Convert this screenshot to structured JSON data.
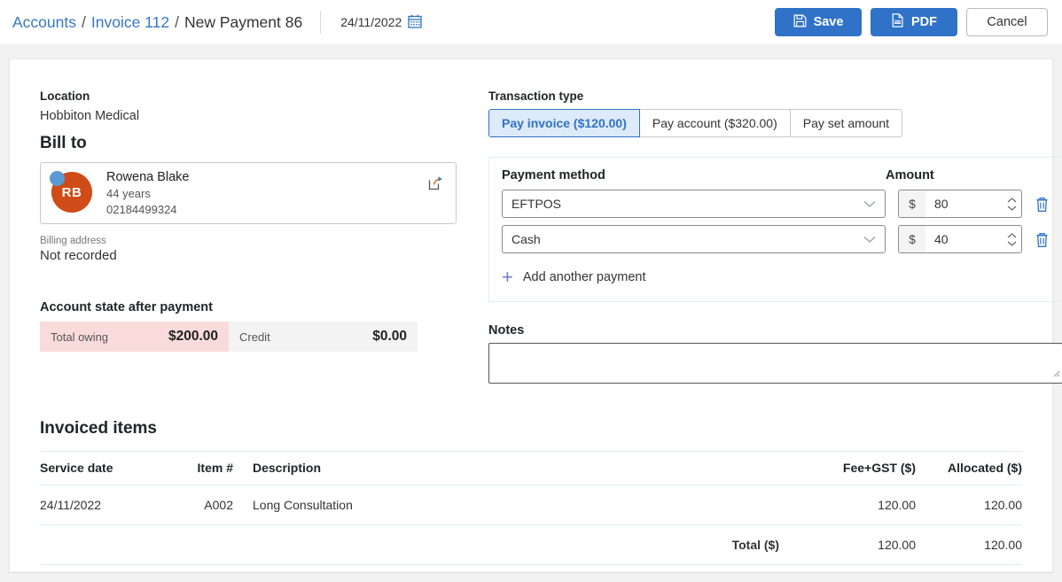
{
  "header": {
    "breadcrumb": [
      {
        "label": "Accounts",
        "link": true
      },
      {
        "label": "Invoice 112",
        "link": true
      },
      {
        "label": "New Payment 86",
        "link": false
      }
    ],
    "separator": "/",
    "date": "24/11/2022",
    "calendar_icon": "calendar-icon",
    "actions": {
      "save": "Save",
      "save_icon": "save-floppy-icon",
      "pdf": "PDF",
      "pdf_icon": "pdf-document-icon",
      "cancel": "Cancel"
    }
  },
  "left": {
    "location_label": "Location",
    "location_value": "Hobbiton Medical",
    "bill_to_heading": "Bill to",
    "patient": {
      "initials": "RB",
      "name": "Rowena Blake",
      "age": "44 years",
      "phone": "02184499324",
      "share_icon": "external-link-icon",
      "status_dot": "online-status-dot"
    },
    "billing_address_label": "Billing address",
    "billing_address_value": "Not recorded",
    "account_state": {
      "title": "Account state after payment",
      "owing_label": "Total owing",
      "owing_value": "$200.00",
      "credit_label": "Credit",
      "credit_value": "$0.00"
    }
  },
  "right": {
    "transaction_type_label": "Transaction type",
    "tabs": [
      {
        "label": "Pay invoice ($120.00)",
        "active": true
      },
      {
        "label": "Pay account ($320.00)",
        "active": false
      },
      {
        "label": "Pay set amount",
        "active": false
      }
    ],
    "payment_method_header": "Payment method",
    "amount_header": "Amount",
    "currency_symbol": "$",
    "payments": [
      {
        "method": "EFTPOS",
        "amount": "80"
      },
      {
        "method": "Cash",
        "amount": "40"
      }
    ],
    "add_payment_label": "Add another payment",
    "add_payment_icon": "plus-icon",
    "delete_icon": "trash-icon",
    "dropdown_icon": "chevron-down-icon",
    "spinner_icon": "stepper-arrows-icon",
    "notes_label": "Notes",
    "notes_value": "",
    "notes_placeholder": ""
  },
  "items": {
    "title": "Invoiced items",
    "columns": [
      "Service date",
      "Item #",
      "Description",
      "Fee+GST ($)",
      "Allocated ($)"
    ],
    "rows": [
      {
        "service_date": "24/11/2022",
        "item_no": "A002",
        "description": "Long Consultation",
        "fee_gst": "120.00",
        "allocated": "120.00"
      }
    ],
    "total_label": "Total ($)",
    "total_fee": "120.00",
    "total_allocated": "120.00"
  },
  "colors": {
    "accent_blue": "#2f72c7",
    "link_blue": "#3877c4",
    "avatar_orange": "#cf4b17",
    "owing_pink": "#fadbdb",
    "tab_active_bg": "#ddeaf9"
  }
}
